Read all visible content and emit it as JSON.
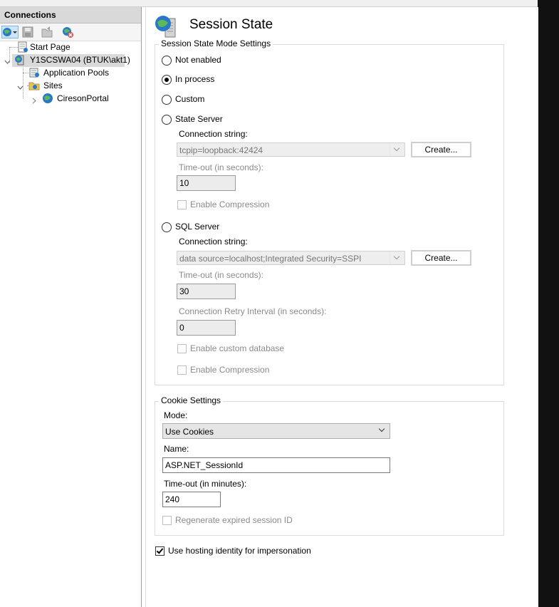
{
  "connections": {
    "header": "Connections",
    "tree": {
      "start_page": "Start Page",
      "server": "Y1SCSWA04 (BTUK\\akt1)",
      "app_pools": "Application Pools",
      "sites": "Sites",
      "site_1": "CiresonPortal"
    },
    "toolbar_icons": [
      "connect-globe-icon",
      "save-icon",
      "open-icon",
      "disconnect-icon"
    ]
  },
  "page": {
    "title": "Session State",
    "mode_group": {
      "legend": "Session State Mode Settings",
      "options": {
        "not_enabled": "Not enabled",
        "in_process": "In process",
        "custom": "Custom",
        "state_server": "State Server",
        "sql_server": "SQL Server"
      },
      "selected": "in_process",
      "state_server": {
        "conn_label": "Connection string:",
        "conn_value": "tcpip=loopback:42424",
        "create_label": "Create...",
        "timeout_label": "Time-out (in seconds):",
        "timeout_value": "10",
        "compression_label": "Enable Compression"
      },
      "sql_server": {
        "conn_label": "Connection string:",
        "conn_value": "data source=localhost;Integrated Security=SSPI",
        "create_label": "Create...",
        "timeout_label": "Time-out (in seconds):",
        "timeout_value": "30",
        "retry_label": "Connection Retry Interval (in seconds):",
        "retry_value": "0",
        "custom_db_label": "Enable custom database",
        "compression_label": "Enable Compression"
      }
    },
    "cookie_group": {
      "legend": "Cookie Settings",
      "mode_label": "Mode:",
      "mode_value": "Use Cookies",
      "name_label": "Name:",
      "name_value": "ASP.NET_SessionId",
      "timeout_label": "Time-out (in minutes):",
      "timeout_value": "240",
      "regen_label": "Regenerate expired session ID"
    },
    "impersonation_label": "Use hosting identity for impersonation",
    "impersonation_checked": true
  }
}
